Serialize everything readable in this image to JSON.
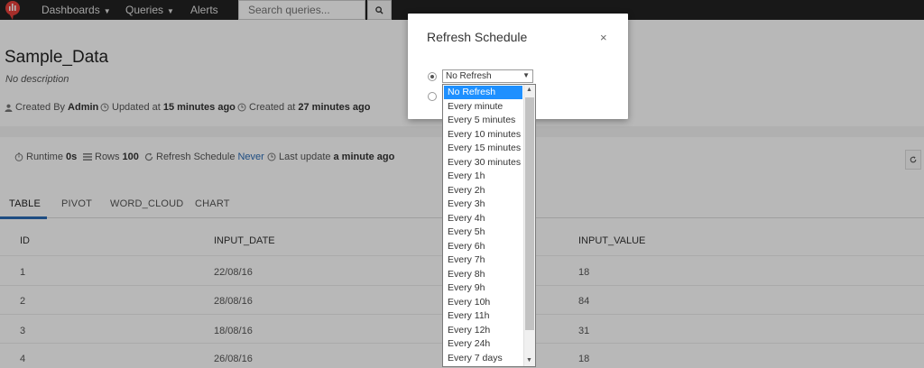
{
  "topbar": {
    "nav": [
      "Dashboards",
      "Queries",
      "Alerts"
    ],
    "search_placeholder": "Search queries..."
  },
  "query": {
    "title": "Sample_Data",
    "description": "No description",
    "created_by_label": "Created By",
    "created_by_value": "Admin",
    "updated_label": "Updated at",
    "updated_value": "15 minutes ago",
    "created_label": "Created at",
    "created_value": "27 minutes ago"
  },
  "stats": {
    "runtime_label": "Runtime",
    "runtime_value": "0s",
    "rows_label": "Rows",
    "rows_value": "100",
    "refresh_label": "Refresh Schedule",
    "refresh_value": "Never",
    "last_update_label": "Last update",
    "last_update_value": "a minute ago"
  },
  "tabs": [
    "TABLE",
    "PIVOT",
    "WORD_CLOUD",
    "CHART"
  ],
  "table": {
    "columns": [
      "ID",
      "INPUT_DATE",
      "INPUT_VALUE"
    ],
    "rows": [
      [
        "1",
        "22/08/16",
        "18"
      ],
      [
        "2",
        "28/08/16",
        "84"
      ],
      [
        "3",
        "18/08/16",
        "31"
      ],
      [
        "4",
        "26/08/16",
        "18"
      ]
    ]
  },
  "modal": {
    "title": "Refresh Schedule",
    "close": "×",
    "selected_value": "No Refresh"
  },
  "dropdown": {
    "options": [
      "No Refresh",
      "Every minute",
      "Every 5 minutes",
      "Every 10 minutes",
      "Every 15 minutes",
      "Every 30 minutes",
      "Every 1h",
      "Every 2h",
      "Every 3h",
      "Every 4h",
      "Every 5h",
      "Every 6h",
      "Every 7h",
      "Every 8h",
      "Every 9h",
      "Every 10h",
      "Every 11h",
      "Every 12h",
      "Every 24h",
      "Every 7 days"
    ],
    "selected_index": 0
  },
  "colors": {
    "topbar": "#222222",
    "accent": "#2a6bb5",
    "selection": "#1e90ff",
    "logo": "#e8413b"
  }
}
